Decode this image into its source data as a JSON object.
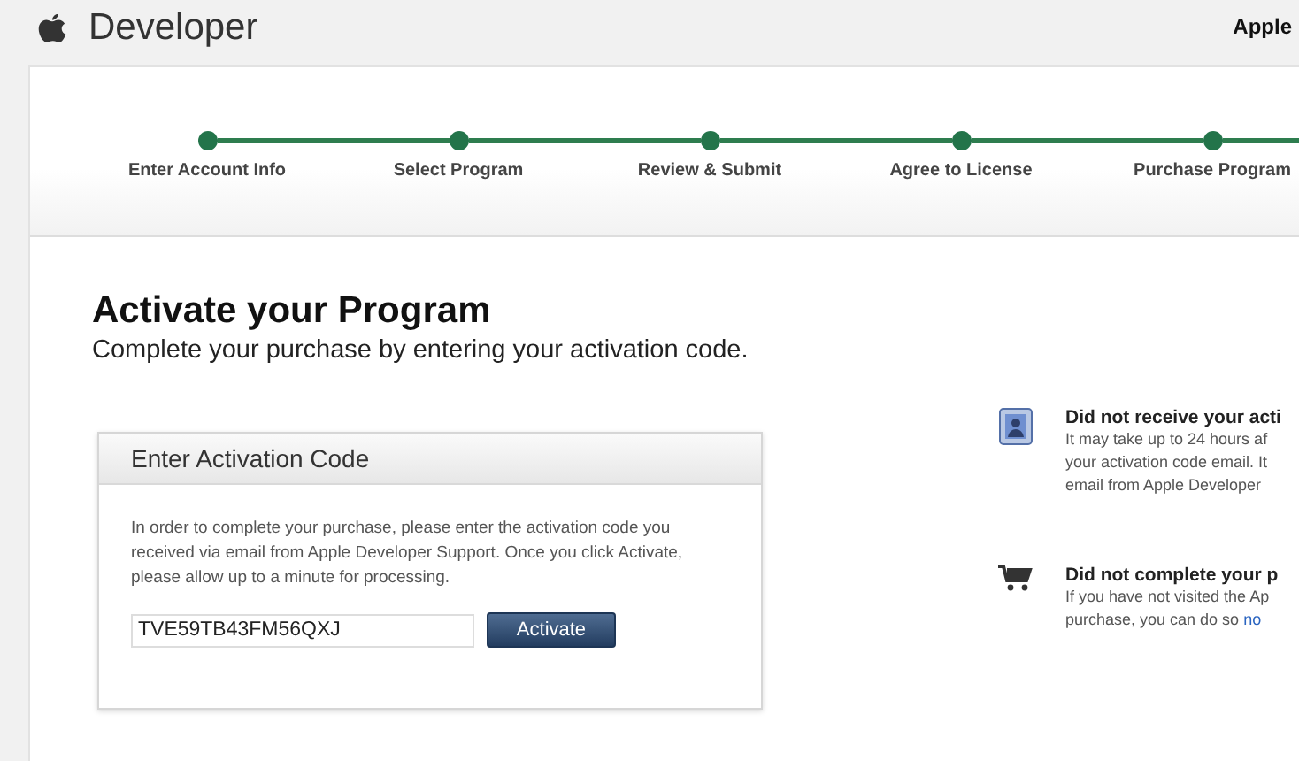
{
  "header": {
    "brand": "Developer",
    "right_link": "Apple"
  },
  "steps": [
    {
      "label": "Enter Account Info"
    },
    {
      "label": "Select Program"
    },
    {
      "label": "Review & Submit"
    },
    {
      "label": "Agree to License"
    },
    {
      "label": "Purchase Program"
    }
  ],
  "page": {
    "title": "Activate your Program",
    "subtitle": "Complete your purchase by entering your activation code."
  },
  "activation_box": {
    "title": "Enter Activation Code",
    "text": "In order to complete your purchase, please enter the activation code you received via email from Apple Developer Support. Once you click Activate, please allow up to a minute for processing.",
    "code": "TVE59TB43FM56QXJ",
    "button": "Activate"
  },
  "help": [
    {
      "kind": "contact",
      "title": "Did not receive your acti",
      "lines": [
        "It may take up to 24 hours af",
        "your activation code email. It",
        "email from Apple Developer"
      ]
    },
    {
      "kind": "cart",
      "title": "Did not complete your p",
      "lines": [
        "If you have not visited the Ap",
        "purchase, you can do so "
      ],
      "link": "no"
    }
  ]
}
